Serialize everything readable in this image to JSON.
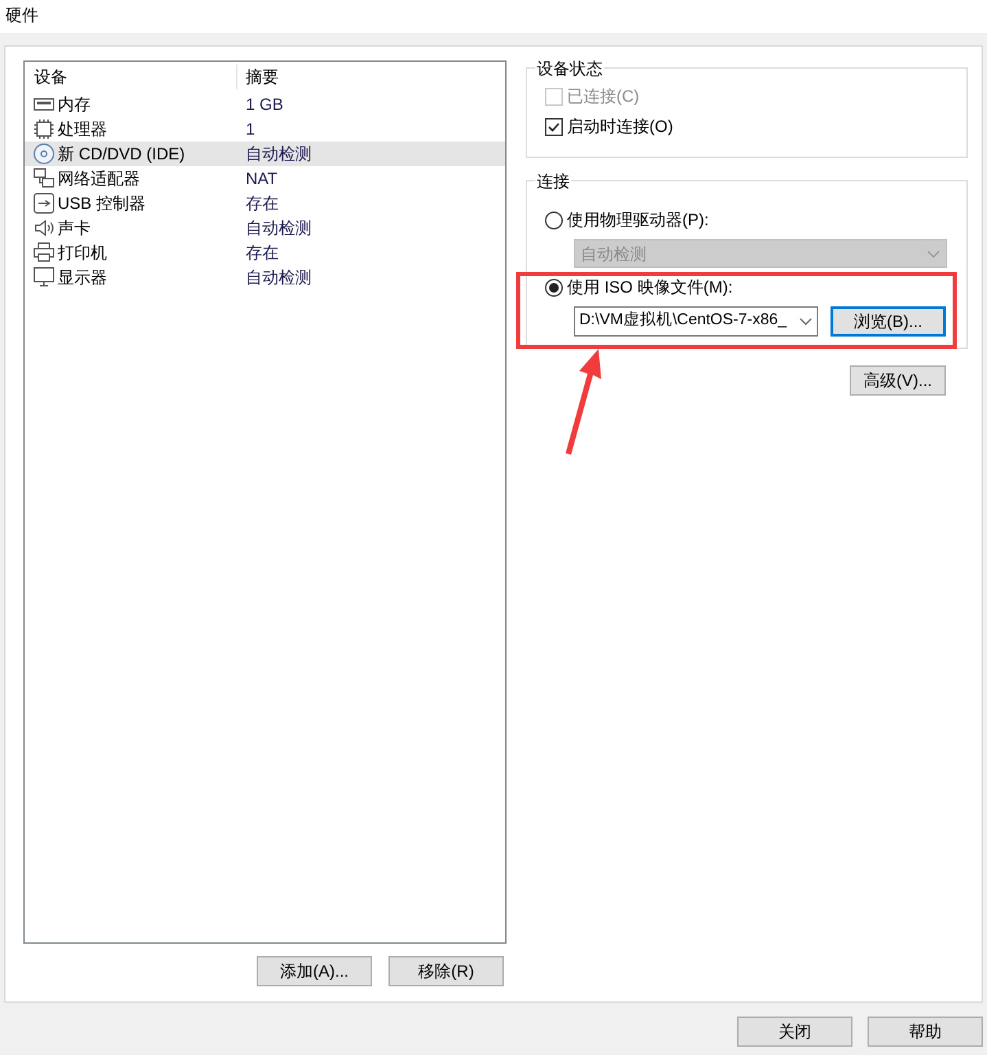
{
  "window": {
    "title": "硬件"
  },
  "device_list": {
    "columns": [
      "设备",
      "摘要"
    ],
    "rows": [
      {
        "kind": "memory",
        "name": "内存",
        "summary": "1 GB",
        "selected": false
      },
      {
        "kind": "cpu",
        "name": "处理器",
        "summary": "1",
        "selected": false
      },
      {
        "kind": "cd",
        "name": "新 CD/DVD (IDE)",
        "summary": "自动检测",
        "selected": true
      },
      {
        "kind": "network",
        "name": "网络适配器",
        "summary": "NAT",
        "selected": false
      },
      {
        "kind": "usb",
        "name": "USB 控制器",
        "summary": "存在",
        "selected": false
      },
      {
        "kind": "sound",
        "name": "声卡",
        "summary": "自动检测",
        "selected": false
      },
      {
        "kind": "printer",
        "name": "打印机",
        "summary": "存在",
        "selected": false
      },
      {
        "kind": "display",
        "name": "显示器",
        "summary": "自动检测",
        "selected": false
      }
    ]
  },
  "list_buttons": [
    "添加(A)...",
    "移除(R)"
  ],
  "device_status": {
    "title": "设备状态",
    "options": [
      {
        "label": "已连接(C)",
        "checked": false,
        "disabled": true
      },
      {
        "label": "启动时连接(O)",
        "checked": true,
        "disabled": false
      }
    ]
  },
  "connection": {
    "title": "连接",
    "physical": {
      "label": "使用物理驱动器(P):",
      "selected": false,
      "drive": "自动检测"
    },
    "iso": {
      "label": "使用 ISO 映像文件(M):",
      "selected": true,
      "path": "D:\\VM虚拟机\\CentOS-7-x86_",
      "browse": "浏览(B)..."
    }
  },
  "advanced_button": "高级(V)...",
  "footer_buttons": [
    "关闭",
    "帮助"
  ]
}
